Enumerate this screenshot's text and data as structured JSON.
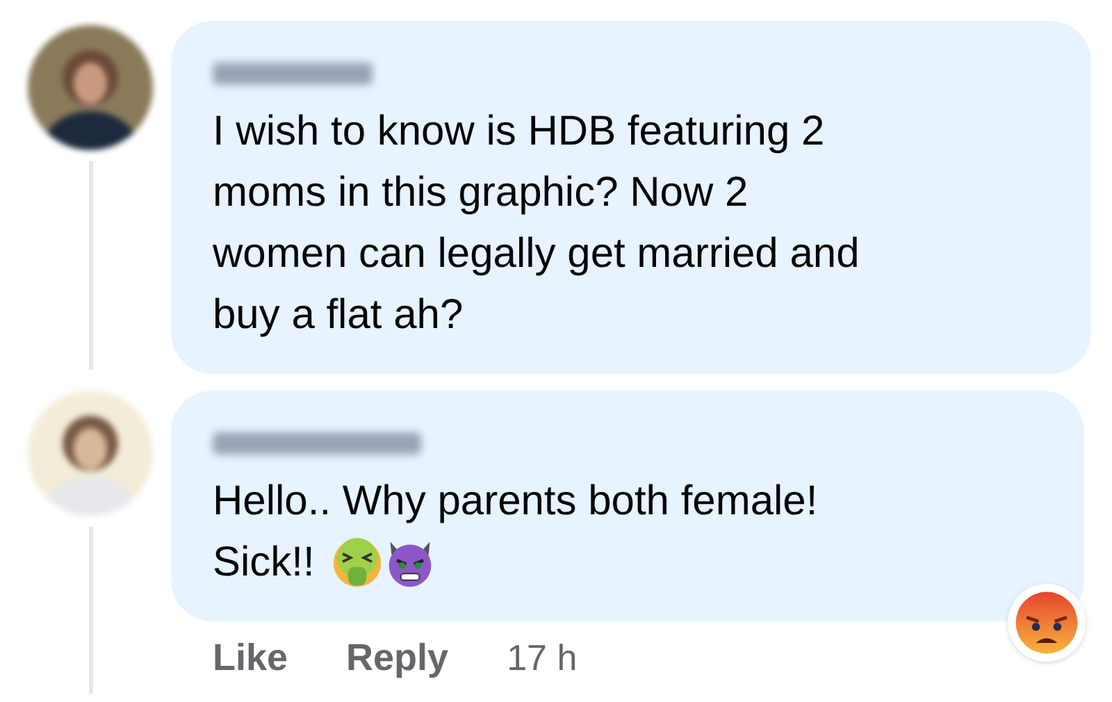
{
  "comments": [
    {
      "lines": [
        "I wish to know is HDB featuring 2",
        "moms in this graphic? Now 2",
        "women can legally get married and",
        "buy a flat ah?"
      ]
    },
    {
      "lines": [
        "Hello.. Why parents both female!",
        "Sick!!"
      ],
      "emoji_icons": [
        {
          "kind": "nauseated"
        },
        {
          "kind": "devil"
        }
      ],
      "reaction": {
        "kind": "angry"
      },
      "actions": [
        "Like",
        "Reply"
      ],
      "time": "17 h"
    }
  ]
}
